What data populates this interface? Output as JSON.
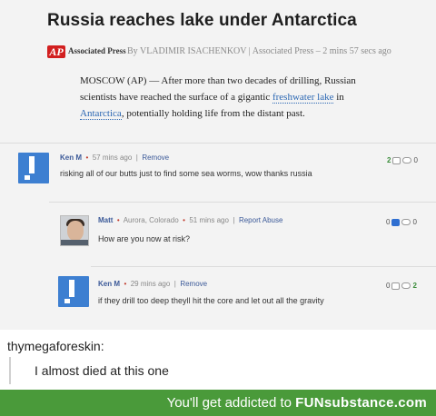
{
  "article": {
    "headline": "Russia reaches lake under Antarctica",
    "logo_text": "AP",
    "source_name": "Associated Press",
    "byline": "By VLADIMIR ISACHENKOV | Associated Press – 2 mins 57 secs ago",
    "body_part1": "MOSCOW (AP) — After more than two decades of drilling, Russian scientists have reached the surface of a gigantic ",
    "link1": "freshwater lake",
    "body_part2": " in ",
    "link2": "Antarctica",
    "body_part3": ", potentially holding life from the distant past."
  },
  "comments": [
    {
      "author": "Ken M",
      "time": "57 mins ago",
      "action": "Remove",
      "text": "risking all of our butts just to find some sea worms, wow thanks russia",
      "up": "2",
      "down": "0"
    },
    {
      "author": "Matt",
      "location": "Aurora, Colorado",
      "time": "51 mins ago",
      "action": "Report Abuse",
      "text": "How are you now at risk?",
      "up": "0",
      "down": "0"
    },
    {
      "author": "Ken M",
      "time": "29 mins ago",
      "action": "Remove",
      "text": "if they drill too deep theyll hit the core and let out all the gravity",
      "up": "0",
      "down": "2"
    }
  ],
  "post": {
    "username": "thymegaforeskin:",
    "reply": "I almost died at this one"
  },
  "footer": {
    "tagline": "You'll get addicted to ",
    "brand": "FUNsubstance.com"
  },
  "colors": {
    "ap_red": "#d21f1f",
    "avatar_blue": "#3d7fd1",
    "footer_green": "#4a9a3a",
    "link_blue": "#2b67b3"
  }
}
